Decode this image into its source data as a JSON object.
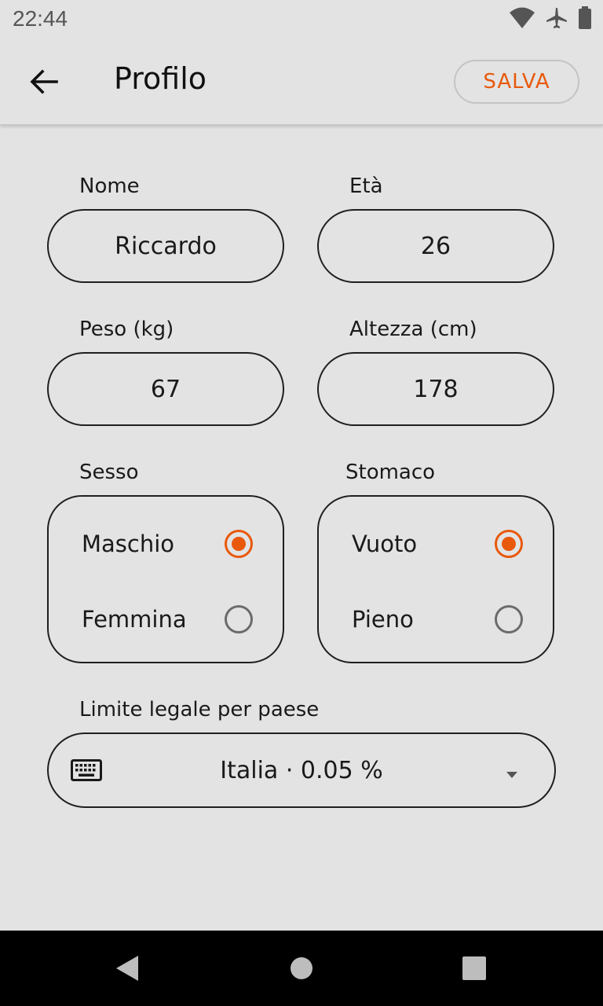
{
  "status_bar": {
    "time": "22:44",
    "icons": [
      "wifi-icon",
      "airplane-icon",
      "battery-icon"
    ]
  },
  "app_bar": {
    "back_icon": "arrow-left-icon",
    "title": "Profilo",
    "save_label": "SALVA"
  },
  "form": {
    "name": {
      "label": "Nome",
      "value": "Riccardo"
    },
    "age": {
      "label": "Età",
      "value": "26"
    },
    "weight": {
      "label": "Peso (kg)",
      "value": "67"
    },
    "height": {
      "label": "Altezza (cm)",
      "value": "178"
    },
    "sex": {
      "label": "Sesso",
      "options": [
        {
          "label": "Maschio",
          "checked": true
        },
        {
          "label": "Femmina",
          "checked": false
        }
      ]
    },
    "stomach": {
      "label": "Stomaco",
      "options": [
        {
          "label": "Vuoto",
          "checked": true
        },
        {
          "label": "Pieno",
          "checked": false
        }
      ]
    },
    "legal_limit": {
      "label": "Limite legale per paese",
      "value": "Italia · 0.05 %",
      "icon": "keyboard-icon"
    }
  },
  "nav_bar": {
    "icons": [
      "back-triangle-icon",
      "home-circle-icon",
      "recents-square-icon"
    ]
  },
  "colors": {
    "accent": "#e8590c",
    "background": "#e3e3e3",
    "nav_bar": "#000000"
  }
}
